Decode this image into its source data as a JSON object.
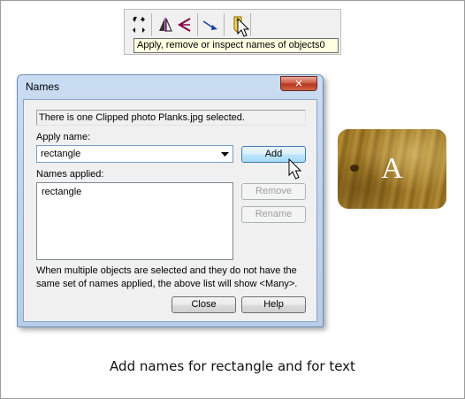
{
  "toolbar": {
    "tooltip": "Apply, remove or inspect names of objects",
    "tooltip_tail": "0",
    "icons": [
      "arrows-icon",
      "flip-icon",
      "shape-icon",
      "connector-icon",
      "tag-icon"
    ]
  },
  "dialog": {
    "title": "Names",
    "close_label": "✕",
    "info": "There is one Clipped photo Planks.jpg selected.",
    "apply_label": "Apply name:",
    "apply_value": "rectangle",
    "names_label": "Names applied:",
    "names_applied": [
      "rectangle"
    ],
    "add_label": "Add",
    "remove_label": "Remove",
    "rename_label": "Rename",
    "note": "When multiple objects are selected and they do not have the same set of names applied, the above list will show <Many>.",
    "close_button_label": "Close",
    "help_label": "Help"
  },
  "preview": {
    "letter": "A"
  },
  "caption": "Add names for rectangle and for text"
}
